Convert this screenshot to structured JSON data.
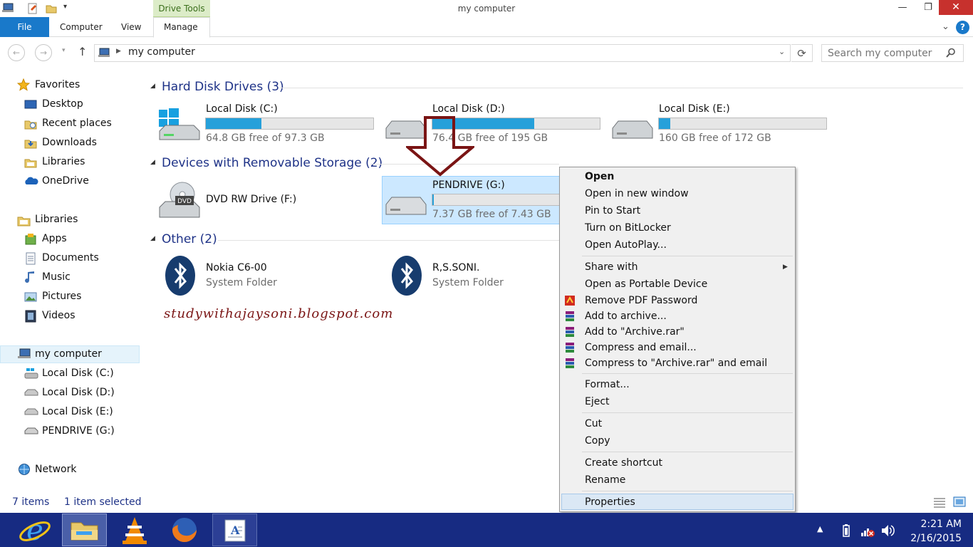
{
  "window": {
    "title": "my computer",
    "context_tab": "Drive Tools",
    "minimize": "—",
    "maximize": "❐",
    "close": "✕"
  },
  "ribbon": {
    "file": "File",
    "tabs": [
      "Computer",
      "View",
      "Manage"
    ]
  },
  "address": {
    "path": "my computer",
    "search_placeholder": "Search my computer"
  },
  "nav": {
    "favorites": {
      "label": "Favorites",
      "items": [
        "Desktop",
        "Recent places",
        "Downloads",
        "Libraries",
        "OneDrive"
      ]
    },
    "libraries": {
      "label": "Libraries",
      "items": [
        "Apps",
        "Documents",
        "Music",
        "Pictures",
        "Videos"
      ]
    },
    "computer": {
      "label": "my computer",
      "items": [
        "Local Disk (C:)",
        "Local Disk (D:)",
        "Local Disk (E:)",
        "PENDRIVE (G:)"
      ]
    },
    "network": "Network"
  },
  "content": {
    "groups": {
      "hdd": "Hard Disk Drives (3)",
      "removable": "Devices with Removable Storage (2)",
      "other": "Other (2)"
    },
    "drives": [
      {
        "name": "Local Disk (C:)",
        "free": "64.8 GB free of 97.3 GB",
        "used_fraction": 0.33
      },
      {
        "name": "Local Disk (D:)",
        "free": "76.4 GB free of 195 GB",
        "used_fraction": 0.61
      },
      {
        "name": "Local Disk (E:)",
        "free": "160 GB free of 172 GB",
        "used_fraction": 0.07
      }
    ],
    "removable": [
      {
        "name": "DVD RW Drive (F:)"
      },
      {
        "name": "PENDRIVE (G:)",
        "free": "7.37 GB free of 7.43 GB",
        "used_fraction": 0.01
      }
    ],
    "other": [
      {
        "name": "Nokia C6-00",
        "type": "System Folder"
      },
      {
        "name": "R,S.SONI.",
        "type": "System Folder"
      }
    ],
    "watermark": "studywithajaysoni.blogspot.com"
  },
  "context_menu": {
    "items": [
      "Open",
      "Open in new window",
      "Pin to Start",
      "Turn on BitLocker",
      "Open AutoPlay...",
      "Share with",
      "Open as Portable Device",
      "Remove PDF Password",
      "Add to archive...",
      "Add to \"Archive.rar\"",
      "Compress and email...",
      "Compress to \"Archive.rar\" and email",
      "Format...",
      "Eject",
      "Cut",
      "Copy",
      "Create shortcut",
      "Rename",
      "Properties"
    ]
  },
  "status": {
    "items": "7 items",
    "selected": "1 item selected"
  },
  "taskbar": {
    "time": "2:21 AM",
    "date": "2/16/2015"
  },
  "colors": {
    "accent": "#1979ca",
    "bar_fill": "#26a0da",
    "taskbar": "#172b82",
    "group_header": "#1e3287",
    "selection": "#cce8ff",
    "arrow": "#7a1414"
  }
}
